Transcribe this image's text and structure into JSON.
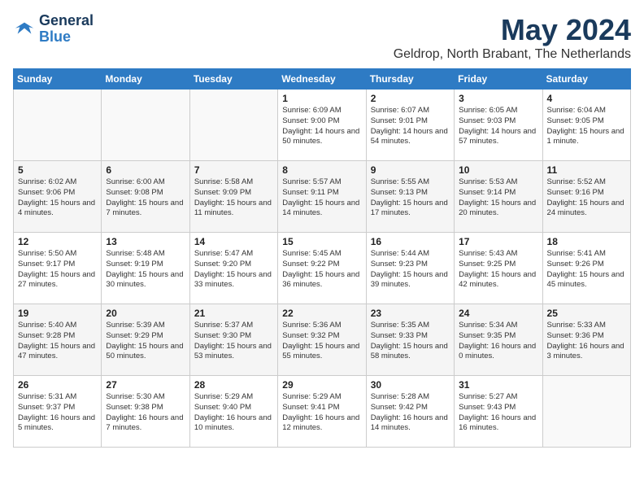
{
  "header": {
    "logo_general": "General",
    "logo_blue": "Blue",
    "month": "May 2024",
    "location": "Geldrop, North Brabant, The Netherlands"
  },
  "days_of_week": [
    "Sunday",
    "Monday",
    "Tuesday",
    "Wednesday",
    "Thursday",
    "Friday",
    "Saturday"
  ],
  "weeks": [
    {
      "days": [
        {
          "num": "",
          "sunrise": "",
          "sunset": "",
          "daylight": ""
        },
        {
          "num": "",
          "sunrise": "",
          "sunset": "",
          "daylight": ""
        },
        {
          "num": "",
          "sunrise": "",
          "sunset": "",
          "daylight": ""
        },
        {
          "num": "1",
          "sunrise": "Sunrise: 6:09 AM",
          "sunset": "Sunset: 9:00 PM",
          "daylight": "Daylight: 14 hours and 50 minutes."
        },
        {
          "num": "2",
          "sunrise": "Sunrise: 6:07 AM",
          "sunset": "Sunset: 9:01 PM",
          "daylight": "Daylight: 14 hours and 54 minutes."
        },
        {
          "num": "3",
          "sunrise": "Sunrise: 6:05 AM",
          "sunset": "Sunset: 9:03 PM",
          "daylight": "Daylight: 14 hours and 57 minutes."
        },
        {
          "num": "4",
          "sunrise": "Sunrise: 6:04 AM",
          "sunset": "Sunset: 9:05 PM",
          "daylight": "Daylight: 15 hours and 1 minute."
        }
      ]
    },
    {
      "days": [
        {
          "num": "5",
          "sunrise": "Sunrise: 6:02 AM",
          "sunset": "Sunset: 9:06 PM",
          "daylight": "Daylight: 15 hours and 4 minutes."
        },
        {
          "num": "6",
          "sunrise": "Sunrise: 6:00 AM",
          "sunset": "Sunset: 9:08 PM",
          "daylight": "Daylight: 15 hours and 7 minutes."
        },
        {
          "num": "7",
          "sunrise": "Sunrise: 5:58 AM",
          "sunset": "Sunset: 9:09 PM",
          "daylight": "Daylight: 15 hours and 11 minutes."
        },
        {
          "num": "8",
          "sunrise": "Sunrise: 5:57 AM",
          "sunset": "Sunset: 9:11 PM",
          "daylight": "Daylight: 15 hours and 14 minutes."
        },
        {
          "num": "9",
          "sunrise": "Sunrise: 5:55 AM",
          "sunset": "Sunset: 9:13 PM",
          "daylight": "Daylight: 15 hours and 17 minutes."
        },
        {
          "num": "10",
          "sunrise": "Sunrise: 5:53 AM",
          "sunset": "Sunset: 9:14 PM",
          "daylight": "Daylight: 15 hours and 20 minutes."
        },
        {
          "num": "11",
          "sunrise": "Sunrise: 5:52 AM",
          "sunset": "Sunset: 9:16 PM",
          "daylight": "Daylight: 15 hours and 24 minutes."
        }
      ]
    },
    {
      "days": [
        {
          "num": "12",
          "sunrise": "Sunrise: 5:50 AM",
          "sunset": "Sunset: 9:17 PM",
          "daylight": "Daylight: 15 hours and 27 minutes."
        },
        {
          "num": "13",
          "sunrise": "Sunrise: 5:48 AM",
          "sunset": "Sunset: 9:19 PM",
          "daylight": "Daylight: 15 hours and 30 minutes."
        },
        {
          "num": "14",
          "sunrise": "Sunrise: 5:47 AM",
          "sunset": "Sunset: 9:20 PM",
          "daylight": "Daylight: 15 hours and 33 minutes."
        },
        {
          "num": "15",
          "sunrise": "Sunrise: 5:45 AM",
          "sunset": "Sunset: 9:22 PM",
          "daylight": "Daylight: 15 hours and 36 minutes."
        },
        {
          "num": "16",
          "sunrise": "Sunrise: 5:44 AM",
          "sunset": "Sunset: 9:23 PM",
          "daylight": "Daylight: 15 hours and 39 minutes."
        },
        {
          "num": "17",
          "sunrise": "Sunrise: 5:43 AM",
          "sunset": "Sunset: 9:25 PM",
          "daylight": "Daylight: 15 hours and 42 minutes."
        },
        {
          "num": "18",
          "sunrise": "Sunrise: 5:41 AM",
          "sunset": "Sunset: 9:26 PM",
          "daylight": "Daylight: 15 hours and 45 minutes."
        }
      ]
    },
    {
      "days": [
        {
          "num": "19",
          "sunrise": "Sunrise: 5:40 AM",
          "sunset": "Sunset: 9:28 PM",
          "daylight": "Daylight: 15 hours and 47 minutes."
        },
        {
          "num": "20",
          "sunrise": "Sunrise: 5:39 AM",
          "sunset": "Sunset: 9:29 PM",
          "daylight": "Daylight: 15 hours and 50 minutes."
        },
        {
          "num": "21",
          "sunrise": "Sunrise: 5:37 AM",
          "sunset": "Sunset: 9:30 PM",
          "daylight": "Daylight: 15 hours and 53 minutes."
        },
        {
          "num": "22",
          "sunrise": "Sunrise: 5:36 AM",
          "sunset": "Sunset: 9:32 PM",
          "daylight": "Daylight: 15 hours and 55 minutes."
        },
        {
          "num": "23",
          "sunrise": "Sunrise: 5:35 AM",
          "sunset": "Sunset: 9:33 PM",
          "daylight": "Daylight: 15 hours and 58 minutes."
        },
        {
          "num": "24",
          "sunrise": "Sunrise: 5:34 AM",
          "sunset": "Sunset: 9:35 PM",
          "daylight": "Daylight: 16 hours and 0 minutes."
        },
        {
          "num": "25",
          "sunrise": "Sunrise: 5:33 AM",
          "sunset": "Sunset: 9:36 PM",
          "daylight": "Daylight: 16 hours and 3 minutes."
        }
      ]
    },
    {
      "days": [
        {
          "num": "26",
          "sunrise": "Sunrise: 5:31 AM",
          "sunset": "Sunset: 9:37 PM",
          "daylight": "Daylight: 16 hours and 5 minutes."
        },
        {
          "num": "27",
          "sunrise": "Sunrise: 5:30 AM",
          "sunset": "Sunset: 9:38 PM",
          "daylight": "Daylight: 16 hours and 7 minutes."
        },
        {
          "num": "28",
          "sunrise": "Sunrise: 5:29 AM",
          "sunset": "Sunset: 9:40 PM",
          "daylight": "Daylight: 16 hours and 10 minutes."
        },
        {
          "num": "29",
          "sunrise": "Sunrise: 5:29 AM",
          "sunset": "Sunset: 9:41 PM",
          "daylight": "Daylight: 16 hours and 12 minutes."
        },
        {
          "num": "30",
          "sunrise": "Sunrise: 5:28 AM",
          "sunset": "Sunset: 9:42 PM",
          "daylight": "Daylight: 16 hours and 14 minutes."
        },
        {
          "num": "31",
          "sunrise": "Sunrise: 5:27 AM",
          "sunset": "Sunset: 9:43 PM",
          "daylight": "Daylight: 16 hours and 16 minutes."
        },
        {
          "num": "",
          "sunrise": "",
          "sunset": "",
          "daylight": ""
        }
      ]
    }
  ]
}
